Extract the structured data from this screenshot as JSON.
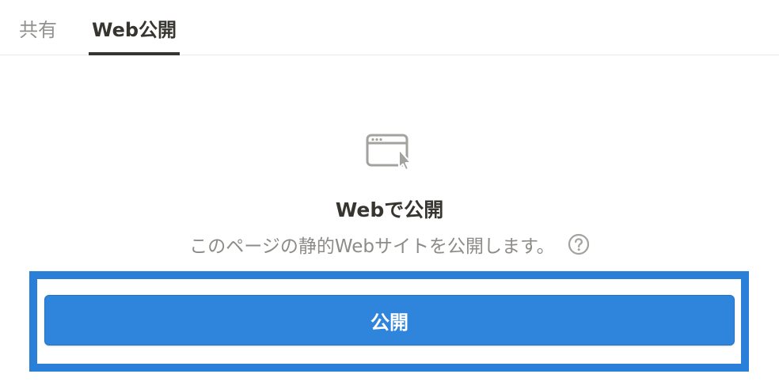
{
  "tabs": {
    "share_label": "共有",
    "publish_label": "Web公開"
  },
  "publish_panel": {
    "icon": "browser-window-cursor-icon",
    "title": "Webで公開",
    "description": "このページの静的Webサイトを公開します。",
    "help_icon": "question-circle-icon",
    "button_label": "公開"
  },
  "colors": {
    "accent": "#2f85dc",
    "highlight": "#2a7fd8",
    "text": "#37352f",
    "muted": "#8c8b88"
  }
}
